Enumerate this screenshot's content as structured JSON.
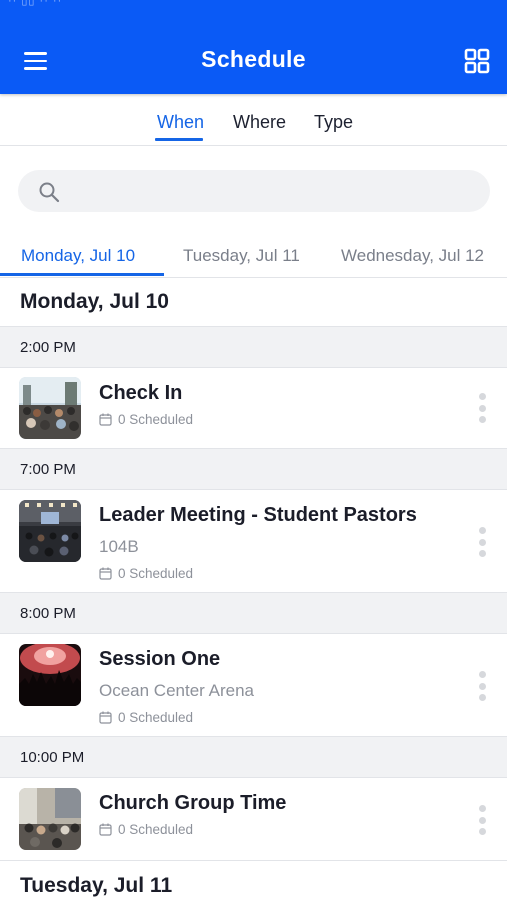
{
  "status_bar": {
    "text": "·· ▯▯ ·· ··"
  },
  "header": {
    "title": "Schedule",
    "menu_icon": "hamburger-menu-icon",
    "grid_icon": "grid-view-icon",
    "color": "#0a5af6"
  },
  "filter_tabs": [
    {
      "label": "When",
      "active": true
    },
    {
      "label": "Where",
      "active": false
    },
    {
      "label": "Type",
      "active": false
    }
  ],
  "search": {
    "placeholder": "",
    "value": "",
    "icon": "search-icon"
  },
  "day_tabs": [
    {
      "label": "Monday, Jul 10",
      "active": true
    },
    {
      "label": "Tuesday, Jul 11",
      "active": false
    },
    {
      "label": "Wednesday, Jul 12",
      "active": false
    }
  ],
  "days": [
    {
      "heading": "Monday, Jul 10"
    },
    {
      "heading": "Tuesday, Jul 11"
    }
  ],
  "groups": [
    {
      "time": "2:00 PM",
      "session": {
        "title": "Check In",
        "location": "",
        "scheduled": "0 Scheduled",
        "thumb": "crowd-outdoor"
      }
    },
    {
      "time": "7:00 PM",
      "session": {
        "title": "Leader Meeting - Student Pastors",
        "location": "104B",
        "scheduled": "0 Scheduled",
        "thumb": "meeting-hall"
      }
    },
    {
      "time": "8:00 PM",
      "session": {
        "title": "Session One",
        "location": "Ocean Center Arena",
        "scheduled": "0 Scheduled",
        "thumb": "concert"
      }
    },
    {
      "time": "10:00 PM",
      "session": {
        "title": "Church Group Time",
        "location": "",
        "scheduled": "0 Scheduled",
        "thumb": "group-room"
      }
    }
  ],
  "colors": {
    "accent": "#1565e6",
    "separator_bg": "#f1f2f4",
    "muted_text": "#8d919a"
  }
}
